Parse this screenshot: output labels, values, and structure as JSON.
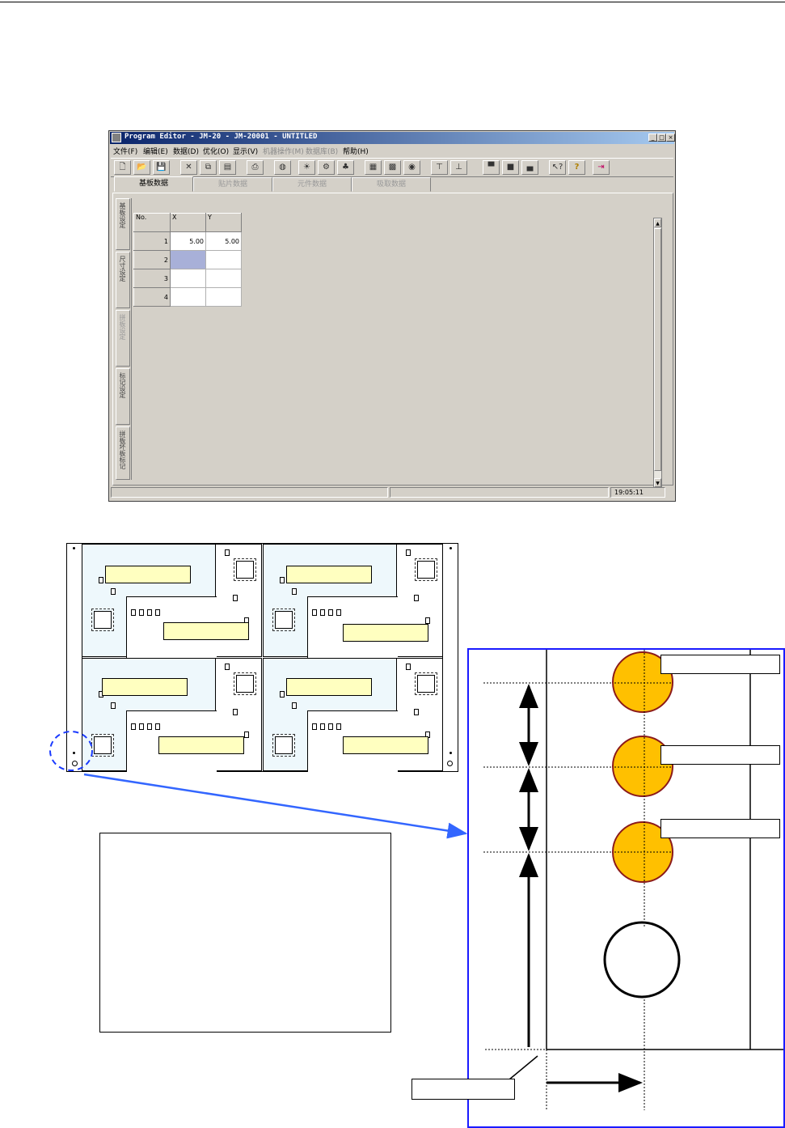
{
  "window": {
    "title": "Program Editor - JM-20 - JM-20001 - UNTITLED",
    "controls": {
      "minimize": "_",
      "maximize": "□",
      "close": "×"
    }
  },
  "menu": [
    {
      "label": "文件(F)",
      "enabled": true
    },
    {
      "label": "编辑(E)",
      "enabled": true
    },
    {
      "label": "数据(D)",
      "enabled": true
    },
    {
      "label": "优化(O)",
      "enabled": true
    },
    {
      "label": "显示(V)",
      "enabled": true
    },
    {
      "label": "机器操作(M)",
      "enabled": false
    },
    {
      "label": "数据库(B)",
      "enabled": false
    },
    {
      "label": "帮助(H)",
      "enabled": true
    }
  ],
  "toolbar": [
    {
      "name": "new-icon",
      "glyph": "🗋"
    },
    {
      "name": "open-icon",
      "glyph": "📂"
    },
    {
      "name": "save-icon",
      "glyph": "💾"
    },
    {
      "name": "cut-icon",
      "glyph": "✕"
    },
    {
      "name": "copy-icon",
      "glyph": "⧉"
    },
    {
      "name": "paste-icon",
      "glyph": "▤"
    },
    {
      "name": "print-icon",
      "glyph": "⎙"
    },
    {
      "name": "find-icon",
      "glyph": "◍"
    },
    {
      "name": "light-icon",
      "glyph": "☀"
    },
    {
      "name": "tool-icon",
      "glyph": "⚙"
    },
    {
      "name": "optimize-icon",
      "glyph": "♣"
    },
    {
      "name": "grid-icon",
      "glyph": "▦"
    },
    {
      "name": "array-icon",
      "glyph": "▩"
    },
    {
      "name": "pick-icon",
      "glyph": "◉"
    },
    {
      "name": "align-top-icon",
      "glyph": "⊤"
    },
    {
      "name": "align-bottom-icon",
      "glyph": "⊥"
    },
    {
      "name": "machine-1-icon",
      "glyph": "▀"
    },
    {
      "name": "machine-2-icon",
      "glyph": "■"
    },
    {
      "name": "machine-3-icon",
      "glyph": "▄"
    },
    {
      "name": "context-help-icon",
      "glyph": "↖?"
    },
    {
      "name": "help-icon",
      "glyph": "?"
    },
    {
      "name": "exit-icon",
      "glyph": "⇥"
    }
  ],
  "tabs": [
    {
      "label": "基板数据",
      "active": true
    },
    {
      "label": "贴片数据",
      "active": false
    },
    {
      "label": "元件数据",
      "active": false
    },
    {
      "label": "吸取数据",
      "active": false
    }
  ],
  "side_tabs": [
    {
      "label": "基板设定",
      "enabled": true
    },
    {
      "label": "尺寸设定",
      "enabled": true
    },
    {
      "label": "拼板设定",
      "enabled": false
    },
    {
      "label": "标记设定",
      "enabled": true
    },
    {
      "label": "拼板坏板标记",
      "enabled": true
    }
  ],
  "grid": {
    "headers": [
      "No.",
      "X",
      "Y"
    ],
    "rows": [
      {
        "no": "1",
        "x": "5.00",
        "y": "5.00"
      },
      {
        "no": "2",
        "x": "",
        "y": ""
      },
      {
        "no": "3",
        "x": "",
        "y": ""
      },
      {
        "no": "4",
        "x": "",
        "y": ""
      }
    ]
  },
  "status": {
    "left": "",
    "middle": "",
    "time": "19:05:11"
  },
  "colors": {
    "title_gradient_start": "#0a246a",
    "board_tint": "#eef8fc",
    "label_fill": "#ffffc0",
    "fiducial_fill": "#ffc000",
    "frame_blue": "#1a1aff"
  }
}
